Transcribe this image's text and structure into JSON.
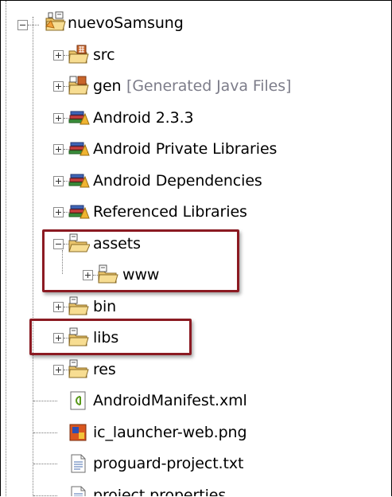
{
  "tree": {
    "root": {
      "label": "nuevoSamsung",
      "icon": "android-project-icon"
    },
    "items": [
      {
        "label": "src",
        "icon": "source-folder-icon"
      },
      {
        "label": "gen",
        "decoration": "[Generated Java Files]",
        "icon": "generated-source-folder-icon"
      },
      {
        "label": "Android 2.3.3",
        "icon": "library-container-icon"
      },
      {
        "label": "Android Private Libraries",
        "icon": "library-container-icon"
      },
      {
        "label": "Android Dependencies",
        "icon": "library-container-icon"
      },
      {
        "label": "Referenced Libraries",
        "icon": "library-container-icon"
      },
      {
        "label": "assets",
        "icon": "folder-open-icon",
        "expanded": true,
        "children": [
          {
            "label": "www",
            "icon": "folder-icon"
          }
        ]
      },
      {
        "label": "bin",
        "icon": "folder-icon"
      },
      {
        "label": "libs",
        "icon": "folder-icon"
      },
      {
        "label": "res",
        "icon": "folder-icon"
      },
      {
        "label": "AndroidManifest.xml",
        "icon": "manifest-file-icon"
      },
      {
        "label": "ic_launcher-web.png",
        "icon": "image-file-icon"
      },
      {
        "label": "proguard-project.txt",
        "icon": "text-file-icon"
      },
      {
        "label": "project.properties",
        "icon": "text-file-icon"
      }
    ]
  },
  "colors": {
    "highlight_border": "#8b1a22",
    "decoration_text": "#7d7d8a",
    "guide": "#7a7a7a"
  }
}
